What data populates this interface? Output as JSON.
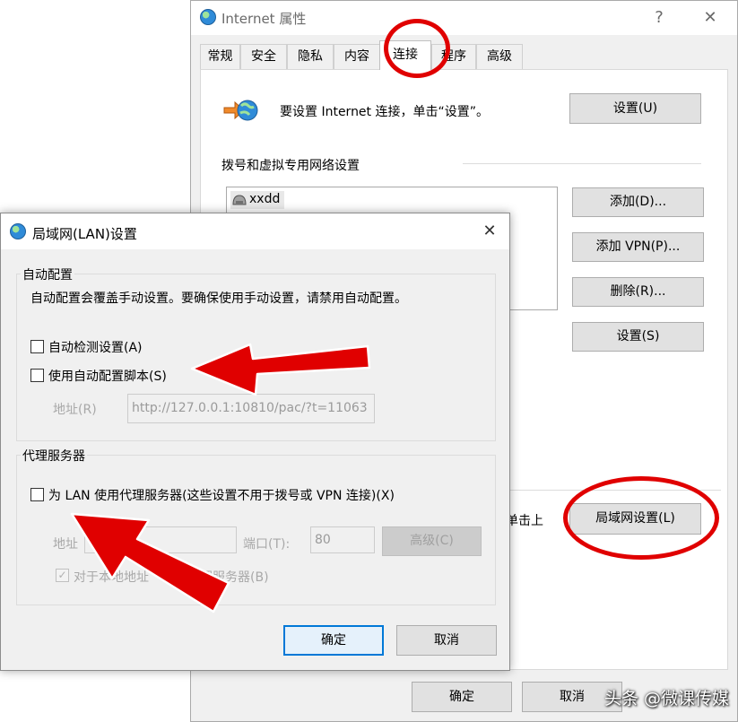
{
  "inet_window": {
    "title": "Internet 属性",
    "help_glyph": "?",
    "close_glyph": "✕",
    "tabs": [
      {
        "label": "常规",
        "active": false
      },
      {
        "label": "安全",
        "active": false
      },
      {
        "label": "隐私",
        "active": false
      },
      {
        "label": "内容",
        "active": false
      },
      {
        "label": "连接",
        "active": true
      },
      {
        "label": "程序",
        "active": false
      },
      {
        "label": "高级",
        "active": false
      }
    ],
    "setup_text": "要设置 Internet 连接，单击“设置”。",
    "setup_button": "设置(U)",
    "dialup_group_title": "拨号和虚拟专用网络设置",
    "dialup_entries": [
      "xxdd"
    ],
    "add_button": "添加(D)...",
    "add_vpn_button": "添加 VPN(P)...",
    "remove_button": "删除(R)...",
    "settings_button": "设置(S)",
    "lan_partial_text": "单击上",
    "lan_settings_button": "局域网设置(L)",
    "ok_button": "确定",
    "cancel_button": "取消"
  },
  "lan_dialog": {
    "title": "局域网(LAN)设置",
    "close_glyph": "✕",
    "auto_config": {
      "title": "自动配置",
      "description": "自动配置会覆盖手动设置。要确保使用手动设置，请禁用自动配置。",
      "auto_detect_label": "自动检测设置(A)",
      "auto_detect_checked": false,
      "use_script_label": "使用自动配置脚本(S)",
      "use_script_checked": false,
      "address_label": "地址(R)",
      "address_value": "http://127.0.0.1:10810/pac/?t=11063"
    },
    "proxy": {
      "title": "代理服务器",
      "use_proxy_label": "为 LAN 使用代理服务器(这些设置不用于拨号或 VPN 连接)(X)",
      "use_proxy_checked": false,
      "address_label": "地址",
      "address_value": "",
      "port_label": "端口(T):",
      "port_value": "80",
      "advanced_button": "高级(C)",
      "bypass_label_a": "对于本地地址",
      "bypass_label_b": "用代理服务器(B)",
      "bypass_checked": true
    },
    "ok_button": "确定",
    "cancel_button": "取消"
  },
  "watermark": "头条 @微课传媒",
  "colors": {
    "annotation_red": "#e00000",
    "focus_blue": "#0078d7",
    "window_bg": "#f0f0f0"
  },
  "icons": {
    "window": "globe-icon",
    "setup": "network-setup-icon",
    "dialup_entry": "dialup-connection-icon",
    "check": "✓"
  }
}
